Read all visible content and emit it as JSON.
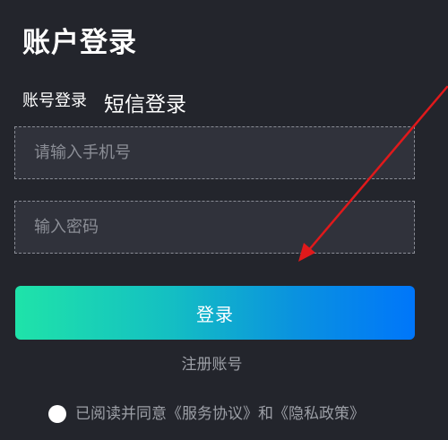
{
  "header": {
    "title": "账户登录"
  },
  "tabs": {
    "account_login": "账号登录",
    "sms_login": "短信登录"
  },
  "form": {
    "phone_placeholder": "请输入手机号",
    "password_placeholder": "输入密码",
    "login_label": "登录",
    "register_label": "注册账号"
  },
  "agreement": {
    "text": "已阅读并同意《服务协议》和《隐私政策》"
  },
  "colors": {
    "background": "#23252c",
    "field_background": "#30323b",
    "gradient_start": "#1fe3a9",
    "gradient_end": "#0076fa",
    "annotation_arrow": "#e0191b"
  }
}
